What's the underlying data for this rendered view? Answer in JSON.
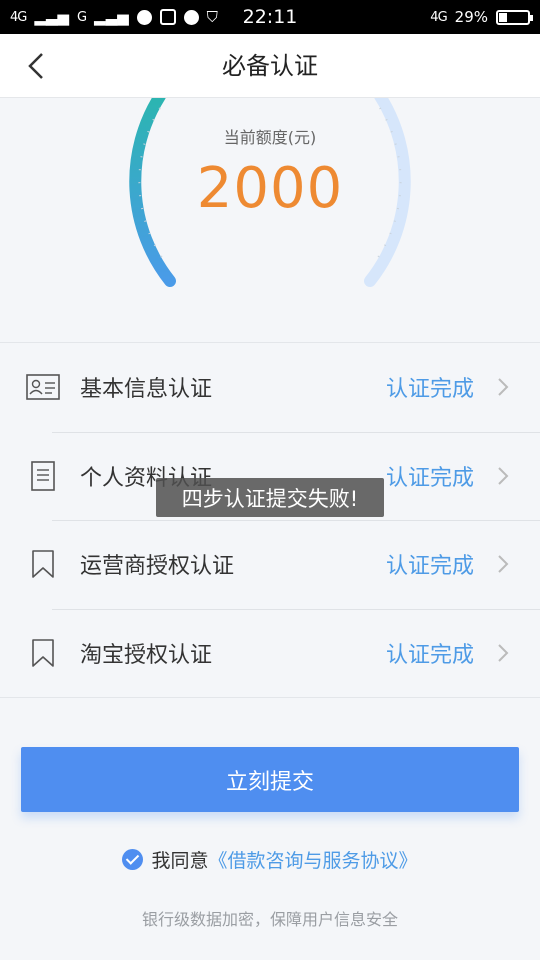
{
  "status_bar": {
    "sim1": "4G",
    "sim2": "G",
    "time": "22:11",
    "network": "4G",
    "battery": "29%",
    "battery_level": 0.29
  },
  "header": {
    "title": "必备认证"
  },
  "gauge": {
    "label": "当前额度(元)",
    "value": "2000"
  },
  "certifications": [
    {
      "label": "基本信息认证",
      "status": "认证完成",
      "icon": "id-card-icon"
    },
    {
      "label": "个人资料认证",
      "status": "认证完成",
      "icon": "document-icon"
    },
    {
      "label": "运营商授权认证",
      "status": "认证完成",
      "icon": "bookmark-icon"
    },
    {
      "label": "淘宝授权认证",
      "status": "认证完成",
      "icon": "bookmark-icon"
    }
  ],
  "toast": {
    "message": "四步认证提交失败!"
  },
  "submit": {
    "label": "立刻提交"
  },
  "agreement": {
    "prefix": "我同意",
    "link": "《借款咨询与服务协议》"
  },
  "footer": {
    "note": "银行级数据加密，保障用户信息安全"
  },
  "colors": {
    "accent": "#4f8ef0",
    "status_text": "#4e9be6",
    "amount": "#ee8a32",
    "gauge_left": "#2bb5b0",
    "gauge_right": "#d6e6fb"
  }
}
